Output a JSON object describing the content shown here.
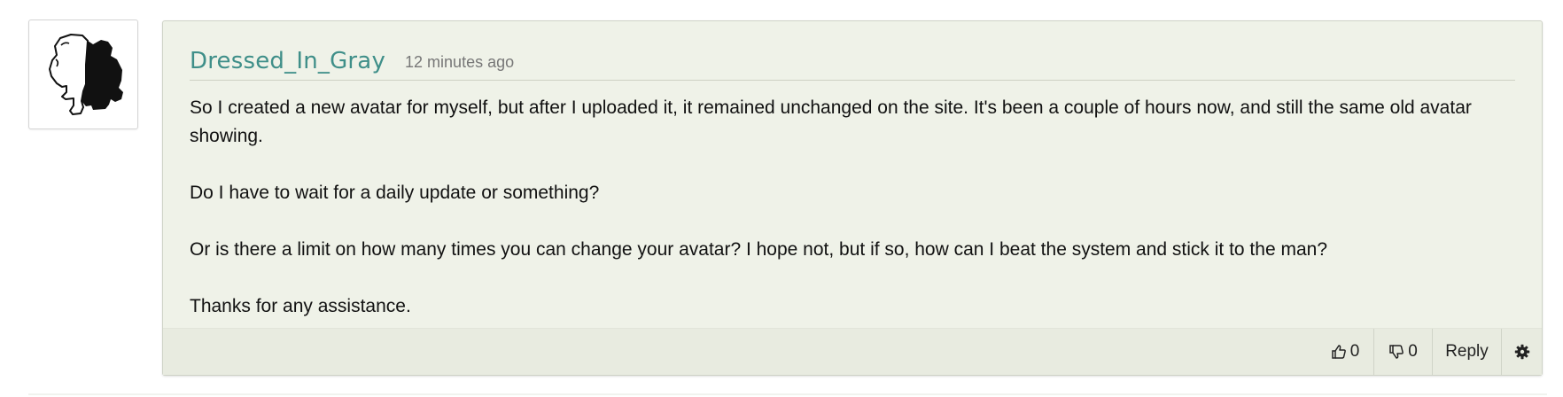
{
  "comment": {
    "author": "Dressed_In_Gray",
    "timestamp": "12 minutes ago",
    "paragraphs": [
      "So I created a new avatar for myself, but after I uploaded it, it remained unchanged on the site. It's been a couple of hours now, and still the same old avatar showing.",
      "Do I have to wait for a daily update or something?",
      "Or is there a limit on how many times you can change your avatar? I hope not, but if so, how can I beat the system and stick it to the man?",
      "Thanks for any assistance."
    ],
    "actions": {
      "upvote_icon": "thumbs-up-icon",
      "upvote_count": "0",
      "downvote_icon": "thumbs-down-icon",
      "downvote_count": "0",
      "reply_label": "Reply",
      "settings_icon": "gear-icon"
    }
  },
  "colors": {
    "username": "#3f8f89",
    "card_background": "#eff2e8",
    "footer_background": "#e8ebe0"
  }
}
